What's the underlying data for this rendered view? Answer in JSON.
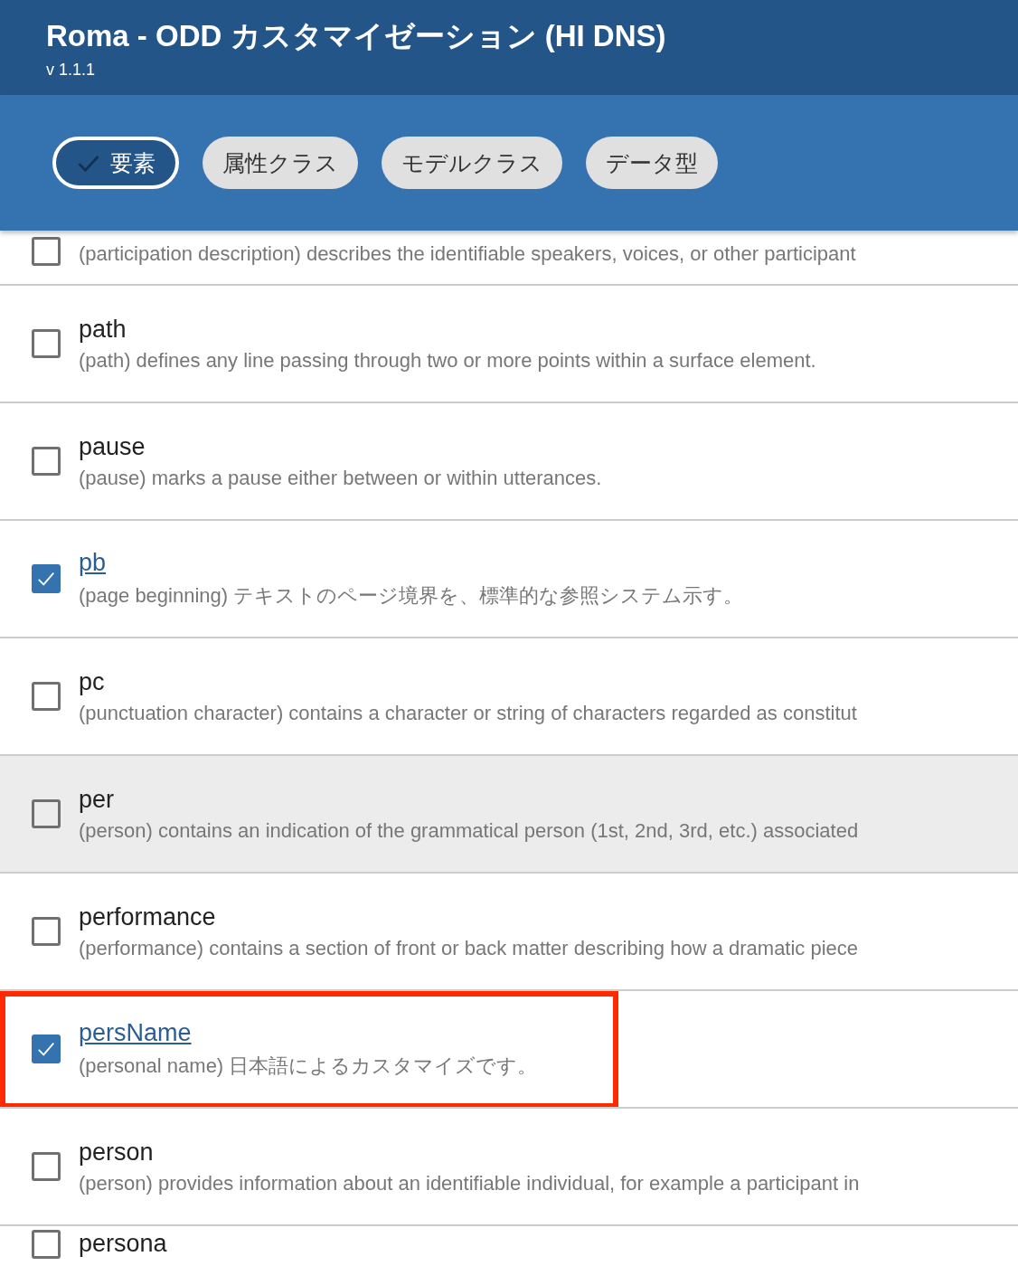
{
  "header": {
    "title": "Roma - ODD カスタマイゼーション (HI DNS)",
    "version": "v 1.1.1"
  },
  "filters": [
    {
      "label": "要素",
      "selected": true
    },
    {
      "label": "属性クラス",
      "selected": false
    },
    {
      "label": "モデルクラス",
      "selected": false
    },
    {
      "label": "データ型",
      "selected": false
    }
  ],
  "elements": [
    {
      "kind": "cut_top",
      "description": "(participation description) describes the identifiable speakers, voices, or other participant",
      "checked": false,
      "hovered": false,
      "annotated": false
    },
    {
      "kind": "full",
      "name": "path",
      "description": "(path) defines any line passing through two or more points within a surface element.",
      "checked": false,
      "hovered": false,
      "annotated": false
    },
    {
      "kind": "full",
      "name": "pause",
      "description": "(pause) marks a pause either between or within utterances.",
      "checked": false,
      "hovered": false,
      "annotated": false
    },
    {
      "kind": "full",
      "name": "pb",
      "description": "(page beginning) テキストのページ境界を、標準的な参照システム示す。",
      "checked": true,
      "hovered": false,
      "annotated": false
    },
    {
      "kind": "full",
      "name": "pc",
      "description": "(punctuation character) contains a character or string of characters regarded as constitut",
      "checked": false,
      "hovered": false,
      "annotated": false
    },
    {
      "kind": "full",
      "name": "per",
      "description": "(person) contains an indication of the grammatical person (1st, 2nd, 3rd, etc.) associated",
      "checked": false,
      "hovered": true,
      "annotated": false
    },
    {
      "kind": "full",
      "name": "performance",
      "description": "(performance) contains a section of front or back matter describing how a dramatic piece",
      "checked": false,
      "hovered": false,
      "annotated": false
    },
    {
      "kind": "full",
      "name": "persName",
      "description": "(personal name) 日本語によるカスタマイズです。",
      "checked": true,
      "hovered": false,
      "annotated": true
    },
    {
      "kind": "full",
      "name": "person",
      "description": "(person) provides information about an identifiable individual, for example a participant in",
      "checked": false,
      "hovered": false,
      "annotated": false
    },
    {
      "kind": "cut_bottom",
      "name": "persona",
      "checked": false,
      "hovered": false,
      "annotated": false
    }
  ]
}
